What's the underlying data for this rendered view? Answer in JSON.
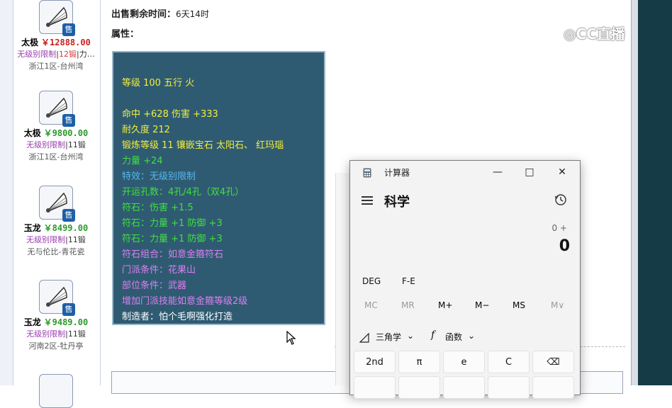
{
  "sidebar": {
    "items": [
      {
        "name": "太极",
        "price": "￥12888.00",
        "price_color": "red",
        "restrict": "无级别限制",
        "sep1": "|",
        "level": "12锻",
        "sep2": "|",
        "extra": "力…",
        "server": "浙江1区-台州湾",
        "icon": "fan-icon",
        "badge": "售"
      },
      {
        "name": "太极",
        "price": "￥9800.00",
        "price_color": "green",
        "restrict": "无级别限制",
        "sep1": "|",
        "level": "11锻",
        "sep2": "",
        "extra": "",
        "server": "浙江1区-台州湾",
        "icon": "fan-icon",
        "badge": "售"
      },
      {
        "name": "玉龙",
        "price": "￥8499.00",
        "price_color": "green",
        "restrict": "无级别限制",
        "sep1": "|",
        "level": "11锻",
        "sep2": "",
        "extra": "",
        "server": "无与伦比-青花瓷",
        "icon": "fan-icon",
        "badge": "售"
      },
      {
        "name": "玉龙",
        "price": "￥9489.00",
        "price_color": "green",
        "restrict": "无级别限制",
        "sep1": "|",
        "level": "11锻",
        "sep2": "",
        "extra": "",
        "server": "河南2区-牡丹亭",
        "icon": "fan-icon",
        "badge": "售"
      }
    ]
  },
  "main": {
    "time_label": "出售剩余时间：",
    "time_value": "6天14时",
    "attr_label": "属性：",
    "attributes": [
      {
        "text": "等级 100 五行 火",
        "color": "yellow"
      },
      {
        "text": "命中 +628 伤害 +333",
        "color": "yellow"
      },
      {
        "text": "耐久度 212",
        "color": "yellow"
      },
      {
        "text": "锻炼等级 11 镶嵌宝石 太阳石、 红玛瑙",
        "color": "yellow"
      },
      {
        "text": "力量 +24",
        "color": "green"
      },
      {
        "text": "特效：无级别限制",
        "color": "blue"
      },
      {
        "text": "开运孔数：4孔/4孔（双4孔）",
        "color": "green"
      },
      {
        "text": "符石：伤害 +1.5",
        "color": "green"
      },
      {
        "text": "符石：力量 +1 防御 +3",
        "color": "green"
      },
      {
        "text": "符石：力量 +1 防御 +3",
        "color": "green"
      },
      {
        "text": "符石组合：如意金箍符石",
        "color": "purple"
      },
      {
        "text": "门派条件：花果山",
        "color": "purple"
      },
      {
        "text": "部位条件：武器",
        "color": "purple"
      },
      {
        "text": "增加门派技能如意金箍等级2级",
        "color": "purple"
      },
      {
        "text": "制造者：怕个毛啊强化打造",
        "color": "white"
      }
    ]
  },
  "watermark": {
    "text": "CC直播",
    "icon": "cc-logo-icon"
  },
  "calculator": {
    "app_icon": "calculator-app-icon",
    "title": "计算器",
    "minimize": "—",
    "maximize": "□",
    "close": "✕",
    "mode": "科学",
    "expression": "0 +",
    "display": "0",
    "angle_unit": "DEG",
    "fe": "F-E",
    "memory": [
      "MC",
      "MR",
      "M+",
      "M−",
      "MS",
      "M∨"
    ],
    "trig_label": "三角学",
    "func_label": "函数",
    "keys": [
      "2nd",
      "π",
      "e",
      "C",
      "⌫"
    ]
  }
}
